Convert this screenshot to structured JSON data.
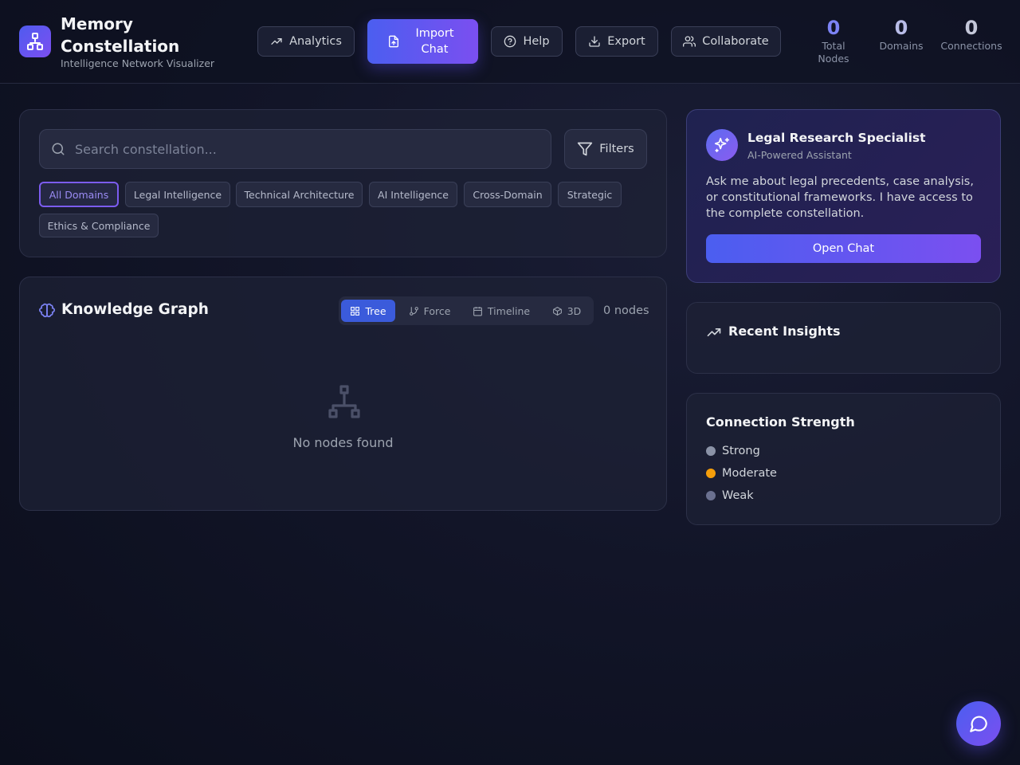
{
  "app": {
    "title": "Memory Constellation",
    "subtitle": "Intelligence Network Visualizer"
  },
  "toolbar": {
    "analytics": "Analytics",
    "import_chat": "Import Chat",
    "help": "Help",
    "export": "Export",
    "collaborate": "Collaborate"
  },
  "stats": [
    {
      "value": "0",
      "label": "Total Nodes",
      "color": "#7c83f5"
    },
    {
      "value": "0",
      "label": "Domains",
      "color": "#b9bde8"
    },
    {
      "value": "0",
      "label": "Connections",
      "color": "#c4c7d9"
    }
  ],
  "search": {
    "placeholder": "Search constellation...",
    "filters_label": "Filters"
  },
  "domains": [
    "All Domains",
    "Legal Intelligence",
    "Technical Architecture",
    "AI Intelligence",
    "Cross-Domain",
    "Strategic",
    "Ethics & Compliance"
  ],
  "active_domain": "All Domains",
  "graph": {
    "title": "Knowledge Graph",
    "views": [
      "Tree",
      "Force",
      "Timeline",
      "3D"
    ],
    "active_view": "Tree",
    "node_count": "0 nodes",
    "empty_text": "No nodes found"
  },
  "assistant": {
    "name": "Legal Research Specialist",
    "role": "AI-Powered Assistant",
    "description": "Ask me about legal precedents, case analysis, or constitutional frameworks. I have access to the complete constellation.",
    "button": "Open Chat"
  },
  "insights": {
    "title": "Recent Insights"
  },
  "connection_strength": {
    "title": "Connection Strength",
    "items": [
      {
        "label": "Strong",
        "color": "#8b93a7"
      },
      {
        "label": "Moderate",
        "color": "#f59e0b"
      },
      {
        "label": "Weak",
        "color": "#6b7190"
      }
    ]
  },
  "icons": {
    "logo": "network-icon",
    "analytics": "trending-up-icon",
    "import": "file-upload-icon",
    "help": "help-circle-icon",
    "export": "download-icon",
    "collaborate": "users-icon",
    "search": "search-icon",
    "filters": "filter-icon",
    "graph": "brain-icon",
    "assistant": "sparkles-icon",
    "insights": "trending-up-icon",
    "fab": "message-circle-icon"
  }
}
